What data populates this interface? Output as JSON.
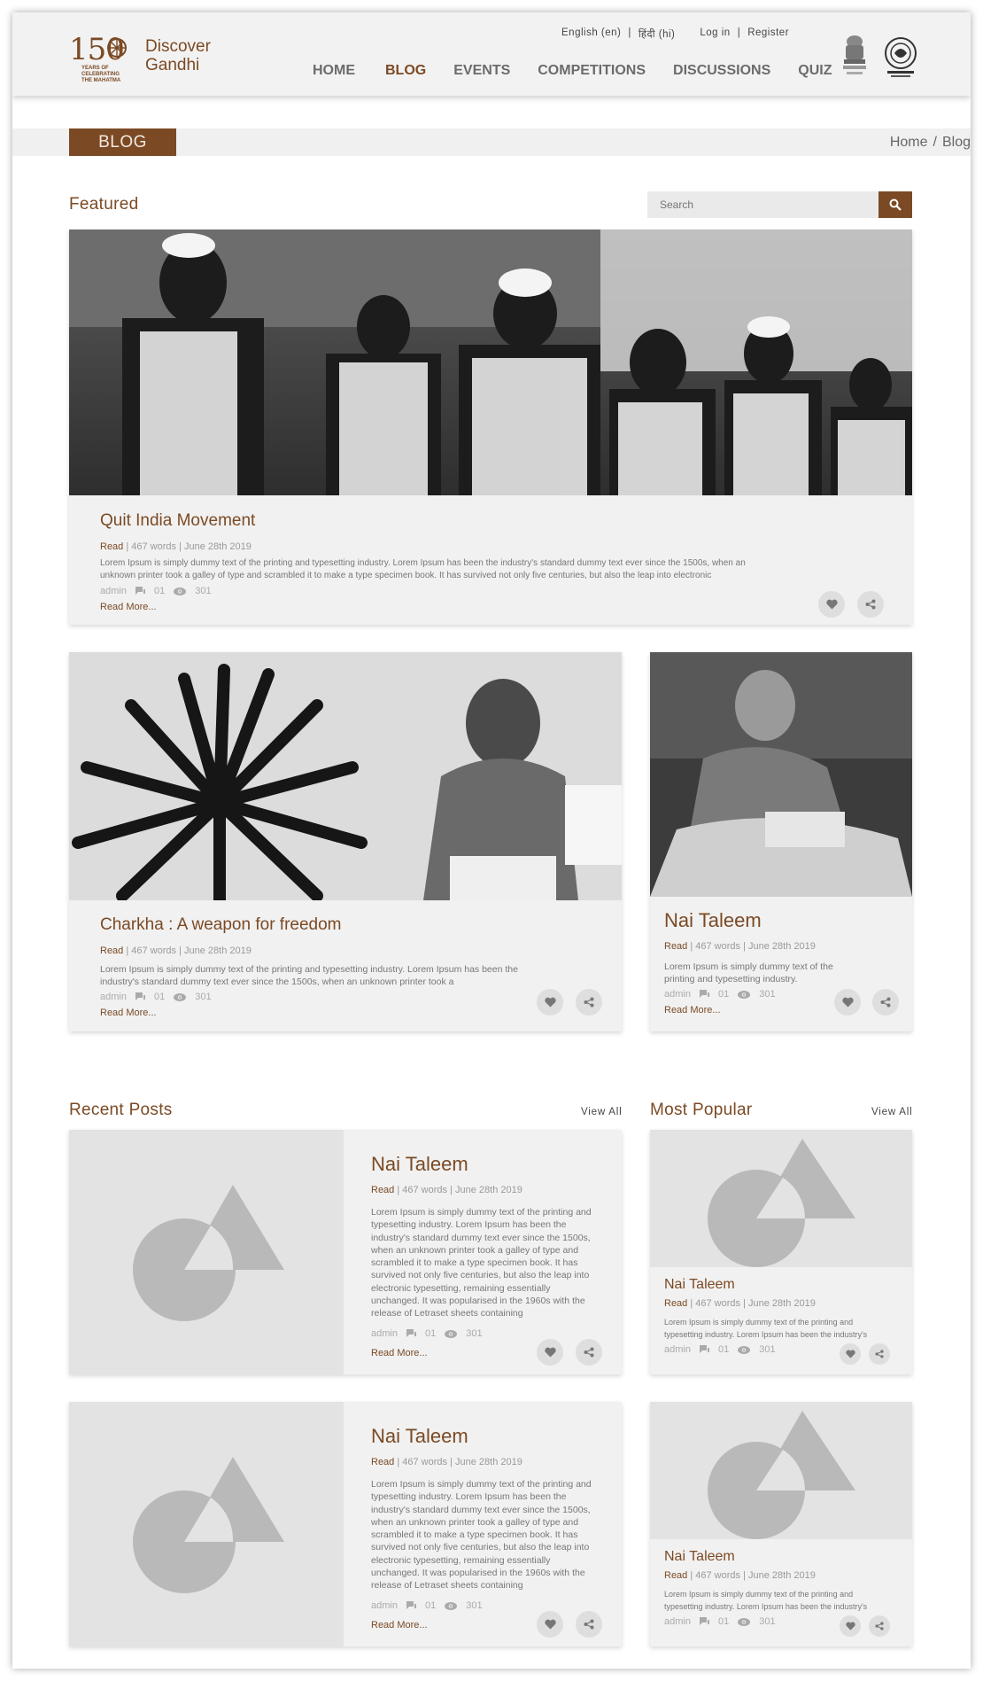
{
  "brand": {
    "years": "150",
    "subtitle": "YEARS OF CELEBRATING THE MAHATMA",
    "name_line1": "Discover",
    "name_line2": "Gandhi"
  },
  "utility": {
    "lang_en": "English (en)",
    "lang_hi": "हिंदी (hi)",
    "login": "Log in",
    "register": "Register"
  },
  "nav": [
    "HOME",
    "BLOG",
    "EVENTS",
    "COMPETITIONS",
    "DISCUSSIONS",
    "QUIZ"
  ],
  "page": {
    "title": "BLOG",
    "breadcrumb_home": "Home",
    "breadcrumb_sep": "/",
    "breadcrumb_current": "Blog"
  },
  "featured": {
    "heading": "Featured",
    "search_placeholder": "Search",
    "post": {
      "title": "Quit India Movement",
      "read": "Read",
      "meta": "| 467 words | June 28th 2019",
      "excerpt": "Lorem Ipsum is simply dummy text of the printing and typesetting industry. Lorem Ipsum has been the industry's standard dummy text ever since the 1500s, when an unknown printer took a galley of type and scrambled it to make a type specimen book. It has survived not only five centuries, but also the leap into electronic typesetting,",
      "author": "admin",
      "comments": "01",
      "views": "301",
      "read_more": "Read More..."
    }
  },
  "row2": [
    {
      "title": "Charkha : A weapon for freedom",
      "read": "Read",
      "meta": "| 467 words | June 28th 2019",
      "excerpt": "Lorem Ipsum is simply dummy text of the printing and typesetting industry. Lorem Ipsum has been the industry's standard dummy text ever since the 1500s, when an unknown printer took a",
      "author": "admin",
      "comments": "01",
      "views": "301",
      "read_more": "Read More..."
    },
    {
      "title": "Nai Taleem",
      "read": "Read",
      "meta": "| 467 words | June 28th 2019",
      "excerpt": "Lorem Ipsum is simply dummy text of the printing and typesetting industry.",
      "author": "admin",
      "comments": "01",
      "views": "301",
      "read_more": "Read More..."
    }
  ],
  "recent": {
    "heading": "Recent Posts",
    "view_all": "View All",
    "posts": [
      {
        "title": "Nai Taleem",
        "read": "Read",
        "meta": "| 467 words | June 28th 2019",
        "excerpt": "Lorem Ipsum is simply dummy text of the printing and typesetting industry. Lorem Ipsum has been the industry's standard dummy text ever since the 1500s, when an unknown printer took a galley of type and scrambled it to make a type specimen book. It has survived not only five centuries, but also the leap into electronic typesetting, remaining essentially unchanged. It was popularised in the 1960s with the release of Letraset sheets containing",
        "author": "admin",
        "comments": "01",
        "views": "301",
        "read_more": "Read More..."
      },
      {
        "title": "Nai Taleem",
        "read": "Read",
        "meta": "| 467 words | June 28th 2019",
        "excerpt": "Lorem Ipsum is simply dummy text of the printing and typesetting industry. Lorem Ipsum has been the industry's standard dummy text ever since the 1500s, when an unknown printer took a galley of type and scrambled it to make a type specimen book. It has survived not only five centuries, but also the leap into electronic typesetting, remaining essentially unchanged. It was popularised in the 1960s with the release of Letraset sheets containing",
        "author": "admin",
        "comments": "01",
        "views": "301",
        "read_more": "Read More..."
      }
    ]
  },
  "popular": {
    "heading": "Most Popular",
    "view_all": "View All",
    "posts": [
      {
        "title": "Nai Taleem",
        "read": "Read",
        "meta": "| 467 words | June 28th 2019",
        "excerpt": "Lorem Ipsum is simply dummy text of the printing and typesetting industry. Lorem Ipsum has been the industry's",
        "author": "admin",
        "comments": "01",
        "views": "301"
      },
      {
        "title": "Nai Taleem",
        "read": "Read",
        "meta": "| 467 words | June 28th 2019",
        "excerpt": "Lorem Ipsum is simply dummy text of the printing and typesetting industry. Lorem Ipsum has been the industry's",
        "author": "admin",
        "comments": "01",
        "views": "301"
      }
    ]
  },
  "colors": {
    "brand_brown": "#7b4a24",
    "card_bg": "#f1f1f1",
    "placeholder_bg": "#e3e3e3",
    "placeholder_shape": "#b9b9b9"
  },
  "icons": [
    "wheel-icon",
    "search-icon",
    "comment-icon",
    "eye-icon",
    "heart-icon",
    "share-icon",
    "emblem-icon",
    "ncert-logo-icon",
    "image-placeholder-icon"
  ]
}
